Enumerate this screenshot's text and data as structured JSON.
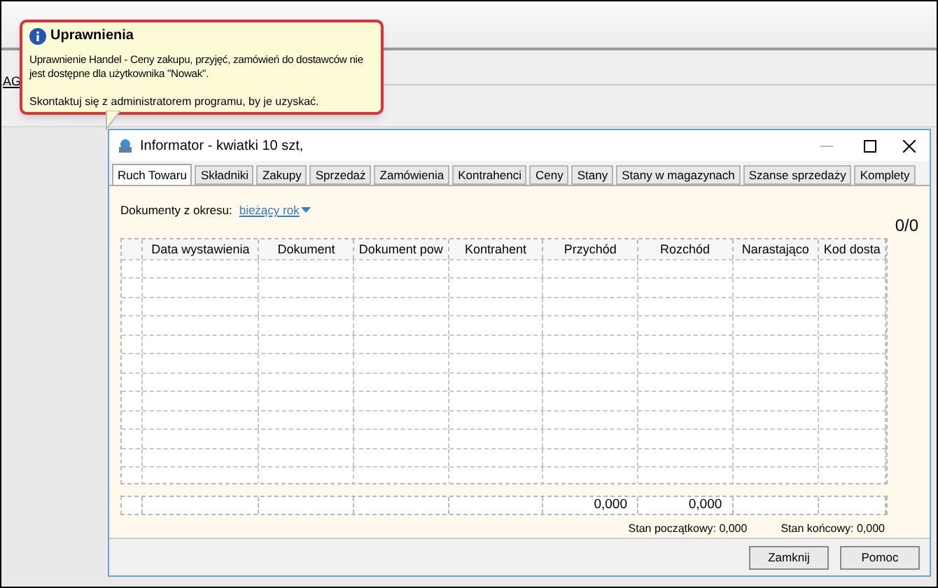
{
  "background": {
    "link": "AG"
  },
  "tooltip": {
    "title": "Uprawnienia",
    "message": "Uprawnienie Handel - Ceny zakupu, przyjęć, zamówień do dostawców nie jest dostępne dla użytkownika \"Nowak\".",
    "hint": "Skontaktuj się z administratorem programu, by je uzyskać."
  },
  "window": {
    "title": "Informator - kwiatki 10 szt,"
  },
  "tabs": [
    {
      "label": "Ruch Towaru",
      "selected": true
    },
    {
      "label": "Składniki",
      "selected": false
    },
    {
      "label": "Zakupy",
      "selected": false
    },
    {
      "label": "Sprzedaż",
      "selected": false
    },
    {
      "label": "Zamówienia",
      "selected": false
    },
    {
      "label": "Kontrahenci",
      "selected": false
    },
    {
      "label": "Ceny",
      "selected": false
    },
    {
      "label": "Stany",
      "selected": false
    },
    {
      "label": "Stany w magazynach",
      "selected": false
    },
    {
      "label": "Szanse sprzedaży",
      "selected": false
    },
    {
      "label": "Komplety",
      "selected": false
    }
  ],
  "period": {
    "label": "Dokumenty z okresu:",
    "value": "bieżący rok"
  },
  "counter": "0/0",
  "table": {
    "columns": [
      "Data wystawienia",
      "Dokument",
      "Dokument pow",
      "Kontrahent",
      "Przychód",
      "Rozchód",
      "Narastająco",
      "Kod dosta"
    ],
    "totals": {
      "przychod": "0,000",
      "rozchod": "0,000"
    }
  },
  "summary": [
    {
      "label": "Stan początkowy: 0,000"
    },
    {
      "label": "Stan końcowy: 0,000"
    }
  ],
  "buttons": [
    "Zamknij",
    "Pomoc"
  ]
}
